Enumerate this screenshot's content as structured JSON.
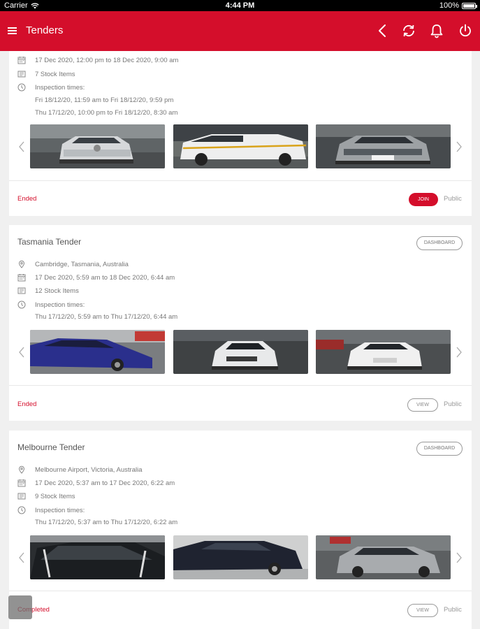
{
  "status_bar": {
    "carrier": "Carrier",
    "time": "4:44 PM",
    "battery": "100%"
  },
  "app_bar": {
    "title": "Tenders",
    "icons": [
      "menu-icon",
      "back-icon",
      "refresh-icon",
      "bell-icon",
      "power-icon"
    ]
  },
  "colors": {
    "brand": "#d40e2b",
    "text": "#555555",
    "muted": "#777777"
  },
  "cards": [
    {
      "title": "",
      "dates": "17 Dec 2020, 12:00 pm  to  18 Dec 2020, 9:00 am",
      "stock": "7 Stock Items",
      "inspection_label": "Inspection times:",
      "inspection": [
        "Fri 18/12/20, 11:59 am to Fri 18/12/20, 9:59 pm",
        "Thu 17/12/20, 10:00 pm to Fri 18/12/20, 8:30 am"
      ],
      "status": "Ended",
      "action": "JOIN",
      "visibility": "Public"
    },
    {
      "title": "Tasmania Tender",
      "dashboard": "DASHBOARD",
      "location": "Cambridge, Tasmania, Australia",
      "dates": "17 Dec 2020, 5:59 am  to  18 Dec 2020, 6:44 am",
      "stock": "12 Stock Items",
      "inspection_label": "Inspection times:",
      "inspection": [
        "Thu 17/12/20, 5:59 am to Thu 17/12/20, 6:44 am"
      ],
      "status": "Ended",
      "action": "VIEW",
      "visibility": "Public"
    },
    {
      "title": "Melbourne Tender",
      "dashboard": "DASHBOARD",
      "location": "Melbourne Airport, Victoria, Australia",
      "dates": "17 Dec 2020, 5:37 am  to  17 Dec 2020, 6:22 am",
      "stock": "9 Stock Items",
      "inspection_label": "Inspection times:",
      "inspection": [
        "Thu 17/12/20, 5:37 am to Thu 17/12/20, 6:22 am"
      ],
      "status": "Completed",
      "action": "VIEW",
      "visibility": "Public"
    }
  ]
}
